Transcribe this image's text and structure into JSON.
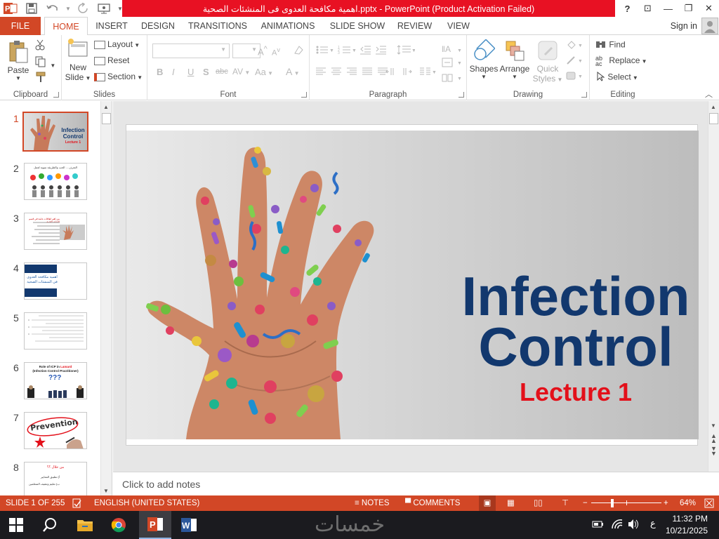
{
  "window": {
    "title": "اهمية مكافحة العدوى فى المنشئات الصحية.pptx - PowerPoint (Product Activation Failed)",
    "controls": {
      "help": "?",
      "ribbon_options": "⊡",
      "minimize": "—",
      "restore": "❐",
      "close": "✕"
    }
  },
  "tabs": [
    "FILE",
    "HOME",
    "INSERT",
    "DESIGN",
    "TRANSITIONS",
    "ANIMATIONS",
    "SLIDE SHOW",
    "REVIEW",
    "VIEW"
  ],
  "account": {
    "signin": "Sign in"
  },
  "ribbon": {
    "clipboard": {
      "label": "Clipboard",
      "paste": "Paste"
    },
    "slides": {
      "label": "Slides",
      "new_slide_1": "New",
      "new_slide_2": "Slide",
      "layout": "Layout",
      "reset": "Reset",
      "section": "Section"
    },
    "font": {
      "label": "Font",
      "bold": "B",
      "italic": "I",
      "underline": "U",
      "shadow": "S",
      "strike": "abc",
      "spacing": "AV",
      "case": "Aa",
      "color": "A",
      "grow": "A",
      "shrink": "A"
    },
    "paragraph": {
      "label": "Paragraph"
    },
    "drawing": {
      "label": "Drawing",
      "shapes": "Shapes",
      "arrange": "Arrange",
      "quick_styles_1": "Quick",
      "quick_styles_2": "Styles"
    },
    "editing": {
      "label": "Editing",
      "find": "Find",
      "replace": "Replace",
      "select": "Select"
    }
  },
  "thumbnails": [
    {
      "num": "1",
      "title_1": "Infection",
      "title_2": "Control",
      "sub": "Lecture 1"
    },
    {
      "num": "2",
      "heading": "التعرف ... الحب والطريقة سوية لعمل"
    },
    {
      "num": "3",
      "heading": "من اهم اتفاقات عامة في قسم العناية الطبية"
    },
    {
      "num": "4",
      "line1": "اهمية مكافحة العدوى",
      "line2": "في المنشئات الصحية"
    },
    {
      "num": "5"
    },
    {
      "num": "6",
      "line1": "Role of ICP in ",
      "line1_accent": "Lamard",
      "line2": "(Infection Control Practitioner)",
      "mark": "???"
    },
    {
      "num": "7",
      "word": "Prevention"
    },
    {
      "num": "8",
      "heading": "من خلال ؟؟",
      "line1": "أ) تطبيق المعايير",
      "line2": "ب) تعليم وتثقيف المتعلمين"
    }
  ],
  "slide": {
    "title_1": "Infection",
    "title_2": "Control",
    "subtitle": "Lecture 1"
  },
  "notes": {
    "placeholder": "Click to add notes"
  },
  "status": {
    "slide": "SLIDE 1 OF 255",
    "language": "ENGLISH (UNITED STATES)",
    "notes": "NOTES",
    "comments": "COMMENTS",
    "zoom": "64%",
    "zoom_fraction": 0.64
  },
  "taskbar": {
    "watermark": "خمسات",
    "time": "11:32 PM",
    "date": "10/21/2025",
    "ime": "ع"
  },
  "colors": {
    "accent": "#d24726",
    "title_bar": "#e81123",
    "slide_title": "#12386e",
    "slide_sub": "#e3101a"
  }
}
